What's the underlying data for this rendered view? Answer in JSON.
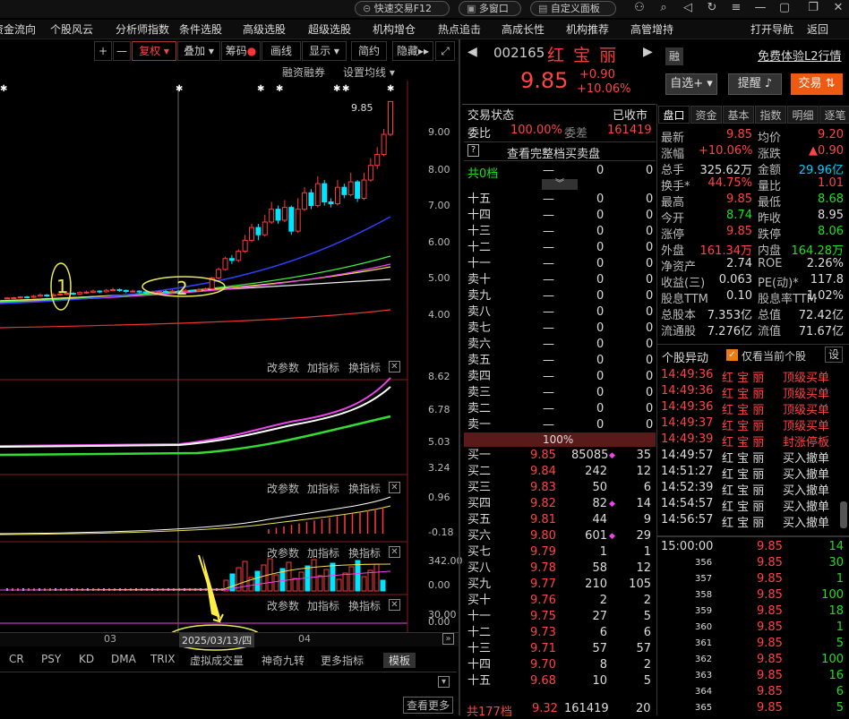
{
  "topbar": {
    "quick_trade": "快速交易F12",
    "multi_window": "多窗口",
    "custom_panel": "自定义面板"
  },
  "menu": [
    "资金流向",
    "个股风云",
    "分析师指数",
    "条件选股",
    "高级选股",
    "超级选股",
    "机构增仓",
    "热点追击",
    "高成长性",
    "机构推荐",
    "高管增持",
    "打开导航",
    "返回"
  ],
  "toolbar": {
    "restore": "复权",
    "overlay": "叠加",
    "chips": "筹码",
    "draw": "画线",
    "display": "显示",
    "simple": "简约",
    "hide": "隐藏",
    "margin": "融资融券",
    "set_ma": "设置均线"
  },
  "chart": {
    "y_ticks": [
      "9.00",
      "8.00",
      "7.00",
      "6.00",
      "5.00",
      "4.00"
    ],
    "high_label": "9.85",
    "annotations": [
      "1",
      "2"
    ],
    "date_highlight": "2025/03/13/四",
    "x_ticks": [
      "03",
      "04"
    ],
    "sub_panels": [
      {
        "ticks": [
          "8.62",
          "6.78",
          "5.03",
          "3.24"
        ],
        "params": "改参数",
        "add": "加指标",
        "switch": "换指标"
      },
      {
        "ticks": [
          "0.96",
          "-0.18"
        ],
        "params": "改参数",
        "add": "加指标",
        "switch": "换指标"
      },
      {
        "ticks": [
          "342.00",
          "0.00"
        ],
        "params": "改参数",
        "add": "加指标",
        "switch": "换指标"
      },
      {
        "ticks": [
          "30.00",
          "0.00"
        ],
        "params": "改参数",
        "add": "加指标",
        "switch": "换指标"
      }
    ],
    "tabs": [
      "CR",
      "PSY",
      "KD",
      "DMA",
      "TRIX",
      "虚拟成交量",
      "神奇九转",
      "更多指标",
      "模板"
    ],
    "more_news": "查看更多",
    "candles": [
      {
        "o": 4.46,
        "c": 4.47,
        "h": 4.5,
        "l": 4.43
      },
      {
        "o": 4.47,
        "c": 4.48,
        "h": 4.5,
        "l": 4.45
      },
      {
        "o": 4.48,
        "c": 4.5,
        "h": 4.52,
        "l": 4.46
      },
      {
        "o": 4.5,
        "c": 4.49,
        "h": 4.53,
        "l": 4.47
      },
      {
        "o": 4.49,
        "c": 4.52,
        "h": 4.55,
        "l": 4.47
      },
      {
        "o": 4.52,
        "c": 4.55,
        "h": 4.6,
        "l": 4.5
      },
      {
        "o": 4.55,
        "c": 4.53,
        "h": 4.58,
        "l": 4.5
      },
      {
        "o": 4.53,
        "c": 4.56,
        "h": 4.6,
        "l": 4.51
      },
      {
        "o": 4.56,
        "c": 4.58,
        "h": 4.62,
        "l": 4.53
      },
      {
        "o": 4.58,
        "c": 4.6,
        "h": 4.66,
        "l": 4.55
      },
      {
        "o": 4.6,
        "c": 4.58,
        "h": 4.63,
        "l": 4.55
      },
      {
        "o": 4.58,
        "c": 4.62,
        "h": 4.65,
        "l": 4.56
      },
      {
        "o": 4.62,
        "c": 4.63,
        "h": 4.67,
        "l": 4.58
      },
      {
        "o": 4.63,
        "c": 4.66,
        "h": 4.7,
        "l": 4.6
      },
      {
        "o": 4.66,
        "c": 4.64,
        "h": 4.68,
        "l": 4.6
      },
      {
        "o": 4.64,
        "c": 4.68,
        "h": 4.72,
        "l": 4.62
      },
      {
        "o": 4.68,
        "c": 4.7,
        "h": 4.75,
        "l": 4.65
      },
      {
        "o": 4.7,
        "c": 4.68,
        "h": 4.73,
        "l": 4.64
      },
      {
        "o": 4.68,
        "c": 4.65,
        "h": 4.7,
        "l": 4.6
      },
      {
        "o": 4.65,
        "c": 4.66,
        "h": 4.7,
        "l": 4.62
      },
      {
        "o": 4.66,
        "c": 4.64,
        "h": 4.68,
        "l": 4.6
      },
      {
        "o": 4.64,
        "c": 4.62,
        "h": 4.66,
        "l": 4.58
      },
      {
        "o": 4.62,
        "c": 4.63,
        "h": 4.67,
        "l": 4.58
      },
      {
        "o": 4.63,
        "c": 4.65,
        "h": 4.68,
        "l": 4.6
      },
      {
        "o": 4.65,
        "c": 4.64,
        "h": 4.69,
        "l": 4.61
      },
      {
        "o": 4.64,
        "c": 4.66,
        "h": 4.7,
        "l": 4.62
      },
      {
        "o": 4.66,
        "c": 4.65,
        "h": 4.68,
        "l": 4.62
      },
      {
        "o": 4.65,
        "c": 4.68,
        "h": 4.72,
        "l": 4.62
      },
      {
        "o": 4.68,
        "c": 4.67,
        "h": 4.7,
        "l": 4.64
      },
      {
        "o": 4.67,
        "c": 4.7,
        "h": 4.74,
        "l": 4.64
      },
      {
        "o": 4.7,
        "c": 4.72,
        "h": 4.76,
        "l": 4.68
      },
      {
        "o": 4.72,
        "c": 5.02,
        "h": 5.05,
        "l": 4.7
      },
      {
        "o": 5.02,
        "c": 5.25,
        "h": 5.3,
        "l": 4.98
      },
      {
        "o": 5.25,
        "c": 5.55,
        "h": 5.6,
        "l": 5.22
      },
      {
        "o": 5.55,
        "c": 5.5,
        "h": 5.65,
        "l": 5.4
      },
      {
        "o": 5.5,
        "c": 5.75,
        "h": 5.8,
        "l": 5.45
      },
      {
        "o": 5.75,
        "c": 6.05,
        "h": 6.2,
        "l": 5.7
      },
      {
        "o": 6.05,
        "c": 6.4,
        "h": 6.5,
        "l": 6.0
      },
      {
        "o": 6.4,
        "c": 6.2,
        "h": 6.5,
        "l": 6.05
      },
      {
        "o": 6.2,
        "c": 6.55,
        "h": 6.75,
        "l": 6.15
      },
      {
        "o": 6.55,
        "c": 6.9,
        "h": 7.1,
        "l": 6.5
      },
      {
        "o": 6.9,
        "c": 6.6,
        "h": 7.0,
        "l": 6.5
      },
      {
        "o": 6.6,
        "c": 6.95,
        "h": 7.15,
        "l": 6.55
      },
      {
        "o": 6.95,
        "c": 6.3,
        "h": 7.0,
        "l": 6.2
      },
      {
        "o": 6.3,
        "c": 6.9,
        "h": 7.2,
        "l": 6.25
      },
      {
        "o": 6.9,
        "c": 7.35,
        "h": 7.5,
        "l": 6.85
      },
      {
        "o": 7.35,
        "c": 7.0,
        "h": 7.45,
        "l": 6.9
      },
      {
        "o": 7.0,
        "c": 7.6,
        "h": 7.8,
        "l": 6.95
      },
      {
        "o": 7.6,
        "c": 7.1,
        "h": 7.7,
        "l": 7.0
      },
      {
        "o": 7.1,
        "c": 7.05,
        "h": 7.2,
        "l": 6.95
      },
      {
        "o": 7.05,
        "c": 7.5,
        "h": 7.7,
        "l": 7.0
      },
      {
        "o": 7.5,
        "c": 7.3,
        "h": 7.6,
        "l": 7.2
      },
      {
        "o": 7.3,
        "c": 7.65,
        "h": 7.9,
        "l": 7.25
      },
      {
        "o": 7.65,
        "c": 7.2,
        "h": 7.7,
        "l": 7.1
      },
      {
        "o": 7.2,
        "c": 7.7,
        "h": 7.9,
        "l": 7.15
      },
      {
        "o": 7.7,
        "c": 8.1,
        "h": 8.3,
        "l": 7.65
      },
      {
        "o": 8.1,
        "c": 8.4,
        "h": 8.6,
        "l": 8.0
      },
      {
        "o": 8.4,
        "c": 8.95,
        "h": 9.1,
        "l": 8.35
      },
      {
        "o": 8.95,
        "c": 9.85,
        "h": 9.85,
        "l": 8.9
      }
    ]
  },
  "stock": {
    "code": "002165",
    "name": "红 宝 丽",
    "price": "9.85",
    "change": "+0.90",
    "pct": "+10.06%",
    "rong": "融",
    "trial": "免费体验L2行情",
    "self_select": "自选",
    "remind": "提醒",
    "trade": "交易"
  },
  "trade_status": {
    "label": "交易状态",
    "value": "已收市",
    "webi_label": "委比",
    "webi": "100.00%",
    "weicha_label": "委差",
    "weicha": "161419",
    "full_book": "查看完整档买卖盘",
    "total_sell_label": "共0档",
    "total_sell": "0",
    "total_sell2": "0",
    "ratio": "100%",
    "total_buy_label": "共177档",
    "total_buy_price": "9.32",
    "total_buy_vol": "161419",
    "total_buy_cnt": "20"
  },
  "sell_levels": [
    [
      "十五",
      "—",
      "0",
      "0"
    ],
    [
      "十四",
      "—",
      "0",
      "0"
    ],
    [
      "十三",
      "—",
      "0",
      "0"
    ],
    [
      "十二",
      "—",
      "0",
      "0"
    ],
    [
      "十一",
      "—",
      "0",
      "0"
    ],
    [
      "卖十",
      "—",
      "0",
      "0"
    ],
    [
      "卖九",
      "—",
      "0",
      "0"
    ],
    [
      "卖八",
      "—",
      "0",
      "0"
    ],
    [
      "卖七",
      "—",
      "0",
      "0"
    ],
    [
      "卖六",
      "—",
      "0",
      "0"
    ],
    [
      "卖五",
      "—",
      "0",
      "0"
    ],
    [
      "卖四",
      "—",
      "0",
      "0"
    ],
    [
      "卖三",
      "—",
      "0",
      "0"
    ],
    [
      "卖二",
      "—",
      "0",
      "0"
    ],
    [
      "卖一",
      "—",
      "0",
      "0"
    ]
  ],
  "buy_levels": [
    [
      "买一",
      "9.85",
      "85085",
      "35"
    ],
    [
      "买二",
      "9.84",
      "242",
      "12"
    ],
    [
      "买三",
      "9.83",
      "50",
      "6"
    ],
    [
      "买四",
      "9.82",
      "82",
      "14"
    ],
    [
      "买五",
      "9.81",
      "44",
      "9"
    ],
    [
      "买六",
      "9.80",
      "601",
      "29"
    ],
    [
      "买七",
      "9.79",
      "1",
      "1"
    ],
    [
      "买八",
      "9.78",
      "58",
      "12"
    ],
    [
      "买九",
      "9.77",
      "210",
      "105"
    ],
    [
      "买十",
      "9.76",
      "2",
      "2"
    ],
    [
      "十一",
      "9.75",
      "27",
      "5"
    ],
    [
      "十二",
      "9.73",
      "6",
      "6"
    ],
    [
      "十三",
      "9.71",
      "57",
      "57"
    ],
    [
      "十四",
      "9.70",
      "8",
      "2"
    ],
    [
      "十五",
      "9.68",
      "10",
      "5"
    ]
  ],
  "quote_tabs": [
    "盘口",
    "资金",
    "基本",
    "指数",
    "明细",
    "逐笔"
  ],
  "quote": [
    [
      "最新",
      "9.85",
      "均价",
      "9.20"
    ],
    [
      "涨幅",
      "+10.06%",
      "涨跌",
      "▲0.90"
    ],
    [
      "总手",
      "325.62万",
      "金额",
      "29.96亿"
    ],
    [
      "换手*",
      "44.75%",
      "量比",
      "1.01"
    ],
    [
      "最高",
      "9.85",
      "最低",
      "8.68"
    ],
    [
      "今开",
      "8.74",
      "昨收",
      "8.95"
    ],
    [
      "涨停",
      "9.85",
      "跌停",
      "8.06"
    ],
    [
      "外盘",
      "161.34万",
      "内盘",
      "164.28万"
    ],
    [
      "净资产",
      "2.74",
      "ROE",
      "2.26%"
    ],
    [
      "收益(三)",
      "0.063",
      "PE(动)*",
      "117.8"
    ],
    [
      "股息TTM",
      "0.10",
      "股息率TTM",
      "1.02%"
    ],
    [
      "总股本",
      "7.353亿",
      "总值",
      "72.42亿"
    ],
    [
      "流通股",
      "7.276亿",
      "流值",
      "71.67亿"
    ]
  ],
  "movements": {
    "title": "个股异动",
    "only_current": "仅看当前个股",
    "settings": "设",
    "rows": [
      [
        "14:49:36",
        "红 宝 丽",
        "顶级买单"
      ],
      [
        "14:49:36",
        "红 宝 丽",
        "顶级买单"
      ],
      [
        "14:49:36",
        "红 宝 丽",
        "顶级买单"
      ],
      [
        "14:49:37",
        "红 宝 丽",
        "顶级买单"
      ],
      [
        "14:49:39",
        "红 宝 丽",
        "封涨停板"
      ],
      [
        "14:49:57",
        "红 宝 丽",
        "买入撤单"
      ],
      [
        "14:51:27",
        "红 宝 丽",
        "买入撤单"
      ],
      [
        "14:52:39",
        "红 宝 丽",
        "买入撤单"
      ],
      [
        "14:54:57",
        "红 宝 丽",
        "买入撤单"
      ],
      [
        "14:56:57",
        "红 宝 丽",
        "买入撤单"
      ]
    ]
  },
  "ticks": [
    [
      "15:00:00",
      "9.85",
      "14"
    ],
    [
      "356",
      "9.85",
      "30"
    ],
    [
      "357",
      "9.85",
      "1"
    ],
    [
      "358",
      "9.85",
      "100"
    ],
    [
      "359",
      "9.85",
      "18"
    ],
    [
      "360",
      "9.85",
      "1"
    ],
    [
      "361",
      "9.85",
      "5"
    ],
    [
      "362",
      "9.85",
      "100"
    ],
    [
      "363",
      "9.85",
      "16"
    ],
    [
      "364",
      "9.85",
      "6"
    ],
    [
      "365",
      "9.85",
      "5"
    ]
  ]
}
